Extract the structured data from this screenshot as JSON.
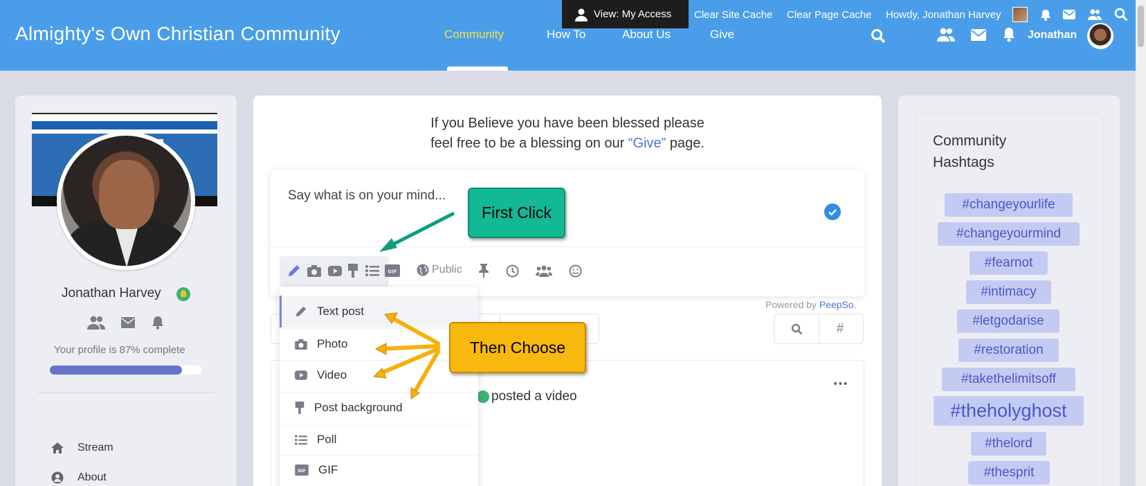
{
  "header": {
    "site_title": "Almighty's Own Christian Community",
    "nav": [
      {
        "label": "Community",
        "active": true
      },
      {
        "label": "How To",
        "active": false
      },
      {
        "label": "About Us",
        "active": false
      },
      {
        "label": "Give",
        "active": false
      }
    ],
    "user_name": "Jonathan"
  },
  "admin_bar": {
    "view_label": "View: My Access",
    "clear_site_cache": "Clear Site Cache",
    "clear_page_cache": "Clear Page Cache",
    "howdy": "Howdy, Jonathan Harvey"
  },
  "profile": {
    "name": "Jonathan Harvey",
    "completion_text": "Your profile is 87% complete",
    "completion_fraction": 0.87,
    "links": [
      {
        "label": "Stream",
        "icon": "home-icon"
      },
      {
        "label": "About",
        "icon": "user-circle-icon"
      }
    ]
  },
  "main": {
    "blessing_line1": "If you Believe you have been blessed please",
    "blessing_line2_pre": "feel free to be a blessing on our ",
    "blessing_link": "“Give”",
    "blessing_line2_post": " page.",
    "composer_placeholder": "Say what is on your mind...",
    "privacy_label": "Public",
    "powered_by": "Powered by ",
    "powered_link": "PeepSo",
    "powered_suffix": ".",
    "post_action": "posted a video",
    "post_types": [
      {
        "label": "Text post",
        "icon": "pencil-icon",
        "active": true
      },
      {
        "label": "Photo",
        "icon": "camera-icon"
      },
      {
        "label": "Video",
        "icon": "video-icon"
      },
      {
        "label": "Post background",
        "icon": "brush-icon"
      },
      {
        "label": "Poll",
        "icon": "list-icon"
      },
      {
        "label": "GIF",
        "icon": "gif-icon"
      }
    ],
    "gif_glyph": "GIF",
    "hash_glyph": "#",
    "more_glyph": "•••"
  },
  "callouts": {
    "first": "First Click",
    "then": "Then Choose"
  },
  "hashtags": {
    "title": "Community Hashtags",
    "tags": [
      "#changeyourlife",
      "#changeyourmind",
      "#fearnot",
      "#intimacy",
      "#letgodarise",
      "#restoration",
      "#takethelimitsoff",
      "#theholyghost",
      "#thelord",
      "#thesprit"
    ]
  },
  "colors": {
    "header": "#4a9ee9",
    "nav_active": "#f5e04a",
    "tag_bg": "#c4cbf2",
    "tag_text": "#4a57c9",
    "callout_green": "#13b894",
    "callout_yellow": "#f9b80e"
  }
}
